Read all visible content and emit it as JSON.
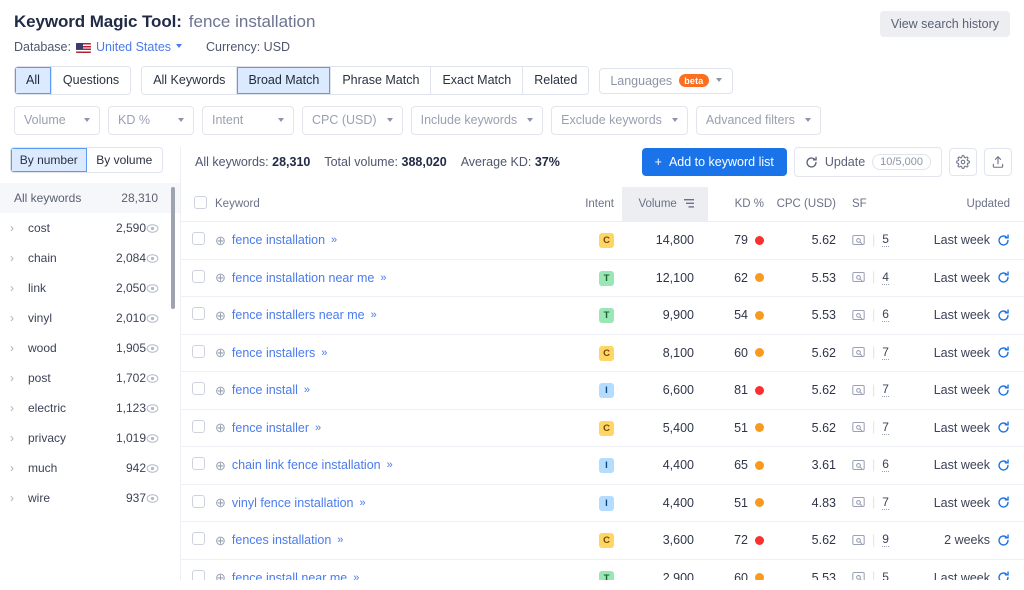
{
  "header": {
    "title": "Keyword Magic Tool:",
    "keyword": "fence installation",
    "database_label": "Database:",
    "database_value": "United States",
    "currency": "Currency: USD",
    "view_history": "View search history"
  },
  "tabs": {
    "group1": [
      {
        "label": "All",
        "active": true
      },
      {
        "label": "Questions",
        "active": false
      }
    ],
    "group2": [
      {
        "label": "All Keywords",
        "active": false
      },
      {
        "label": "Broad Match",
        "active": true
      },
      {
        "label": "Phrase Match",
        "active": false
      },
      {
        "label": "Exact Match",
        "active": false
      },
      {
        "label": "Related",
        "active": false
      }
    ],
    "languages": {
      "label": "Languages",
      "badge": "beta"
    }
  },
  "filters": [
    {
      "label": "Volume"
    },
    {
      "label": "KD %"
    },
    {
      "label": "Intent"
    },
    {
      "label": "CPC (USD)"
    },
    {
      "label": "Include keywords"
    },
    {
      "label": "Exclude keywords"
    },
    {
      "label": "Advanced filters"
    }
  ],
  "sidebar": {
    "toggle": [
      {
        "label": "By number",
        "active": true
      },
      {
        "label": "By volume",
        "active": false
      }
    ],
    "all_keywords_label": "All keywords",
    "all_keywords_count": "28,310",
    "items": [
      {
        "label": "cost",
        "count": "2,590"
      },
      {
        "label": "chain",
        "count": "2,084"
      },
      {
        "label": "link",
        "count": "2,050"
      },
      {
        "label": "vinyl",
        "count": "2,010"
      },
      {
        "label": "wood",
        "count": "1,905"
      },
      {
        "label": "post",
        "count": "1,702"
      },
      {
        "label": "electric",
        "count": "1,123"
      },
      {
        "label": "privacy",
        "count": "1,019"
      },
      {
        "label": "much",
        "count": "942"
      },
      {
        "label": "wire",
        "count": "937"
      }
    ]
  },
  "summary": {
    "all_keywords_label": "All keywords:",
    "all_keywords_value": "28,310",
    "total_volume_label": "Total volume:",
    "total_volume_value": "388,020",
    "average_kd_label": "Average KD:",
    "average_kd_value": "37%",
    "add_button": "Add to keyword list",
    "update_button": "Update",
    "update_quota": "10/5,000"
  },
  "table": {
    "columns": {
      "keyword": "Keyword",
      "intent": "Intent",
      "volume": "Volume",
      "kd": "KD %",
      "cpc": "CPC (USD)",
      "sf": "SF",
      "updated": "Updated"
    },
    "rows": [
      {
        "keyword": "fence installation",
        "intent": "C",
        "volume": "14,800",
        "kd": "79",
        "kd_color": "#f8312f",
        "cpc": "5.62",
        "sf": "5",
        "updated": "Last week"
      },
      {
        "keyword": "fence installation near me",
        "intent": "T",
        "volume": "12,100",
        "kd": "62",
        "kd_color": "#f99a1f",
        "cpc": "5.53",
        "sf": "4",
        "updated": "Last week"
      },
      {
        "keyword": "fence installers near me",
        "intent": "T",
        "volume": "9,900",
        "kd": "54",
        "kd_color": "#f99a1f",
        "cpc": "5.53",
        "sf": "6",
        "updated": "Last week"
      },
      {
        "keyword": "fence installers",
        "intent": "C",
        "volume": "8,100",
        "kd": "60",
        "kd_color": "#f99a1f",
        "cpc": "5.62",
        "sf": "7",
        "updated": "Last week"
      },
      {
        "keyword": "fence install",
        "intent": "I",
        "volume": "6,600",
        "kd": "81",
        "kd_color": "#f8312f",
        "cpc": "5.62",
        "sf": "7",
        "updated": "Last week"
      },
      {
        "keyword": "fence installer",
        "intent": "C",
        "volume": "5,400",
        "kd": "51",
        "kd_color": "#f99a1f",
        "cpc": "5.62",
        "sf": "7",
        "updated": "Last week"
      },
      {
        "keyword": "chain link fence installation",
        "intent": "I",
        "volume": "4,400",
        "kd": "65",
        "kd_color": "#f99a1f",
        "cpc": "3.61",
        "sf": "6",
        "updated": "Last week"
      },
      {
        "keyword": "vinyl fence installation",
        "intent": "I",
        "volume": "4,400",
        "kd": "51",
        "kd_color": "#f99a1f",
        "cpc": "4.83",
        "sf": "7",
        "updated": "Last week"
      },
      {
        "keyword": "fences installation",
        "intent": "C",
        "volume": "3,600",
        "kd": "72",
        "kd_color": "#f8312f",
        "cpc": "5.62",
        "sf": "9",
        "updated": "2 weeks"
      },
      {
        "keyword": "fence install near me",
        "intent": "T",
        "volume": "2,900",
        "kd": "60",
        "kd_color": "#f99a1f",
        "cpc": "5.53",
        "sf": "5",
        "updated": "Last week"
      }
    ]
  },
  "colors": {
    "accent": "#1a73e8",
    "link": "#4b7bec",
    "beta": "#fd6f20",
    "kd_high": "#f8312f",
    "kd_mid": "#f99a1f"
  }
}
